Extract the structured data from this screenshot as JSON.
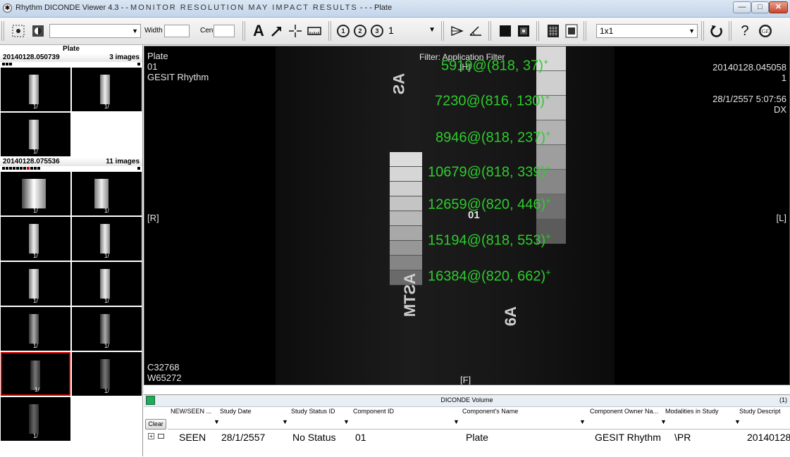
{
  "window": {
    "title_prefix": "Rhythm DICONDE Viewer 4.3 - - ",
    "title_warning": "MONITOR RESOLUTION MAY IMPACT RESULTS",
    "title_suffix": " - - - Plate",
    "minimize_label": "—",
    "maximize_label": "□",
    "close_label": "✕"
  },
  "toolbar": {
    "width_label": "Width",
    "center_label": "Center",
    "text_tool": "A",
    "zoom_value": "1",
    "layout_value": "1x1",
    "help_label": "?"
  },
  "sidebar": {
    "header": "Plate",
    "series": [
      {
        "name": "20140128.050739",
        "count": "3 images",
        "thumbs": [
          "1/",
          "1/",
          "1/"
        ]
      },
      {
        "name": "20140128.075536",
        "count": "11 images",
        "thumbs": [
          "1/",
          "1/",
          "1/",
          "1/",
          "1/",
          "1/",
          "1/",
          "1/",
          "1/",
          "1/",
          "1/"
        ]
      }
    ]
  },
  "viewer": {
    "top_left": "Plate\n01\nGESIT Rhythm",
    "top_center": "Filter: Application Filter",
    "top_right": "20140128.045058\n1\n\n28/1/2557 5:07:56\nDX",
    "left_marker": "[R]",
    "right_marker": "[L]",
    "bottom_marker": "[F]",
    "top_marker": "[H]",
    "bottom_left": "C32768\nW65272",
    "plate_label": "01",
    "measurements": [
      {
        "value": "5919",
        "coords": "(818, 37)"
      },
      {
        "value": "7230",
        "coords": "(816, 130)"
      },
      {
        "value": "8946",
        "coords": "(818, 237)"
      },
      {
        "value": "10679",
        "coords": "(818, 339)"
      },
      {
        "value": "12659",
        "coords": "(820, 446)"
      },
      {
        "value": "15194",
        "coords": "(818, 553)"
      },
      {
        "value": "16384",
        "coords": "(820, 662)"
      }
    ]
  },
  "volume": {
    "title": "DICONDE Volume",
    "count": "(1)",
    "clear_label": "Clear",
    "columns": [
      "NEW/SEEN ...",
      "Study Date",
      "Study Status ID",
      "Component ID",
      "Component's Name",
      "Component Owner Na...",
      "Modalities in Study",
      "Study Descript"
    ],
    "row": [
      "SEEN",
      "28/1/2557",
      "No Status",
      "01",
      "Plate",
      "GESIT Rhythm",
      "\\PR",
      "20140128"
    ]
  }
}
